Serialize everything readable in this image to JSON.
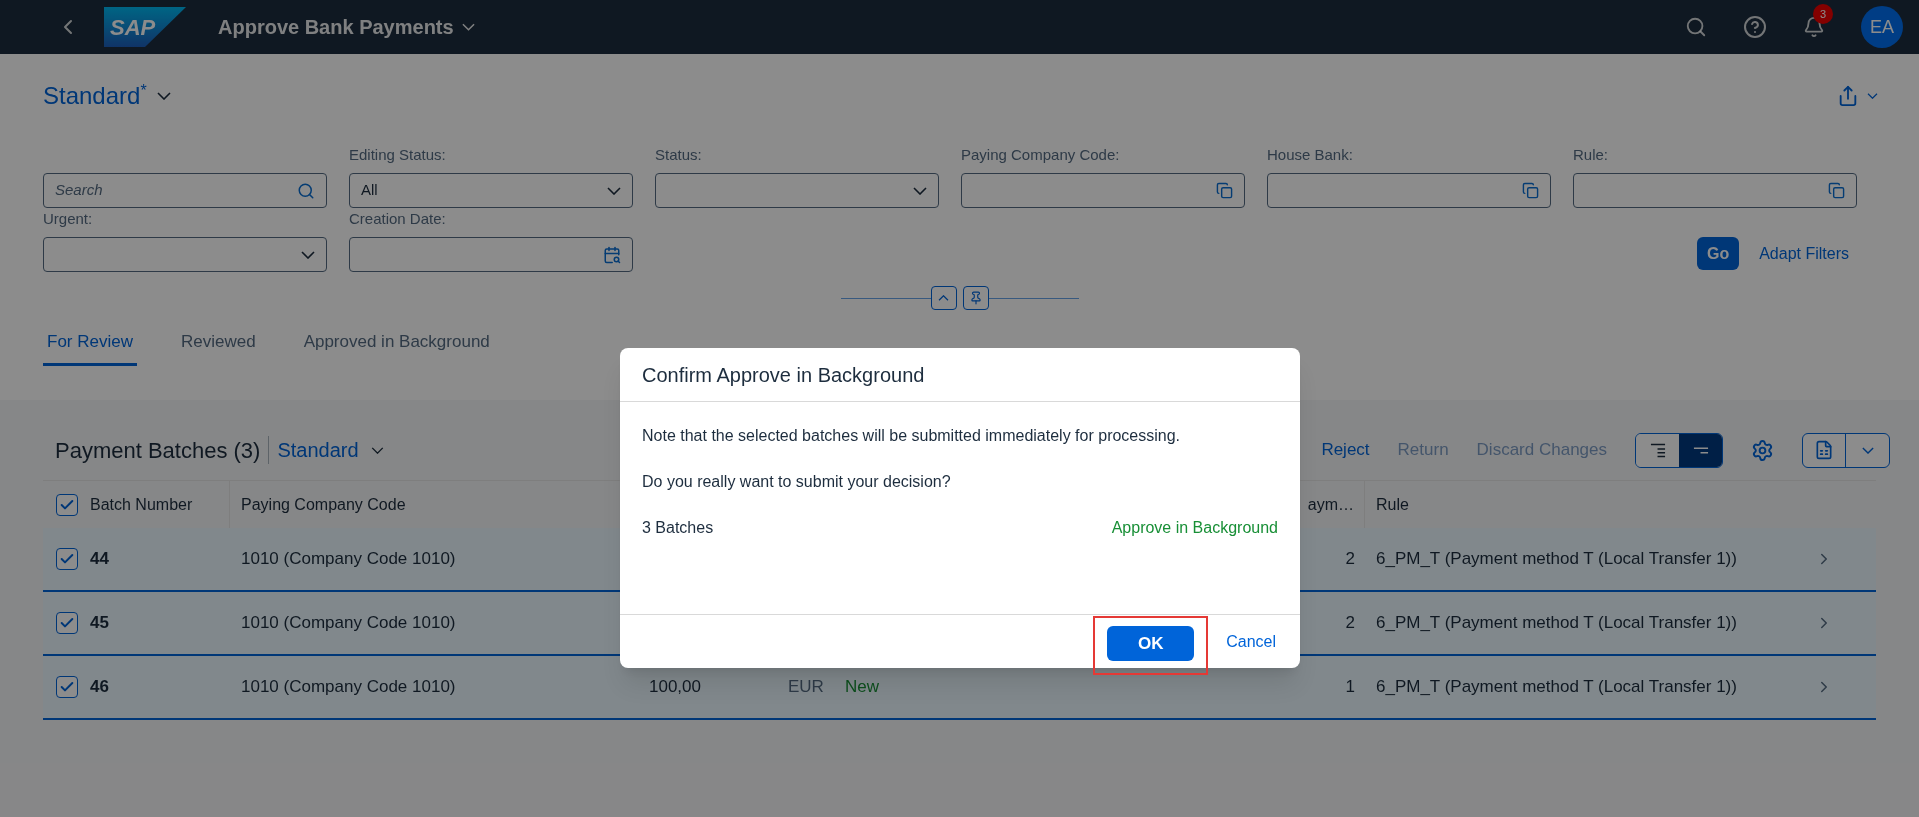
{
  "shell": {
    "title": "Approve Bank Payments",
    "logo": "SAP",
    "notification_count": "3",
    "avatar": "EA"
  },
  "page": {
    "variant": "Standard",
    "modified_mark": "*"
  },
  "filters": [
    {
      "kind": "search",
      "placeholder": "Search"
    },
    {
      "kind": "select",
      "label": "Editing Status:",
      "value": "All"
    },
    {
      "kind": "select",
      "label": "Status:"
    },
    {
      "kind": "valuehelp",
      "label": "Paying Company Code:"
    },
    {
      "kind": "valuehelp",
      "label": "House Bank:"
    },
    {
      "kind": "valuehelp",
      "label": "Rule:"
    },
    {
      "kind": "select",
      "label": "Urgent:"
    },
    {
      "kind": "date",
      "label": "Creation Date:"
    }
  ],
  "filter_actions": {
    "go": "Go",
    "adapt": "Adapt Filters"
  },
  "tabs": [
    {
      "label": "For Review",
      "selected": true
    },
    {
      "label": "Reviewed",
      "selected": false
    },
    {
      "label": "Approved in Background",
      "selected": false
    }
  ],
  "table": {
    "title": "Payment Batches (3)",
    "variant": "Standard",
    "actions": [
      {
        "label": "Reject",
        "disabled": false
      },
      {
        "label": "Return",
        "disabled": true
      },
      {
        "label": "Discard Changes",
        "disabled": true
      }
    ],
    "view_toggle": [
      {
        "selected": false
      },
      {
        "selected": true
      }
    ],
    "select_all_checked": true,
    "columns": {
      "batch": "Batch Number",
      "company": "Paying Company Code",
      "count": "aym…",
      "rule": "Rule"
    },
    "rows": [
      {
        "checked": true,
        "batch": "44",
        "company": "1010 (Company Code 1010)",
        "count": "2",
        "rule": "6_PM_T (Payment method T (Local Transfer 1))"
      },
      {
        "checked": true,
        "batch": "45",
        "company": "1010 (Company Code 1010)",
        "count": "2",
        "rule": "6_PM_T (Payment method T (Local Transfer 1))"
      },
      {
        "checked": true,
        "batch": "46",
        "company": "1010 (Company Code 1010)",
        "amount": "100,00",
        "currency": "EUR",
        "status": "New",
        "count": "1",
        "rule": "6_PM_T (Payment method T (Local Transfer 1))"
      }
    ]
  },
  "dialog": {
    "title": "Confirm Approve in Background",
    "messages": [
      "Note that the selected batches will be submitted immediately for processing.",
      "Do you really want to submit your decision?"
    ],
    "count": "3 Batches",
    "decision": "Approve in Background",
    "ok": "OK",
    "cancel": "Cancel",
    "ok_highlighted": true
  }
}
